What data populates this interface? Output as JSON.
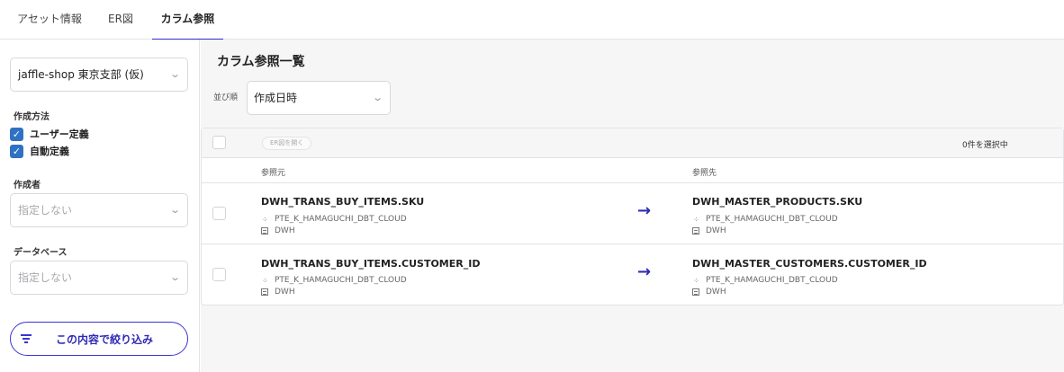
{
  "tabs": [
    {
      "label": "アセット情報"
    },
    {
      "label": "ER図"
    },
    {
      "label": "カラム参照"
    }
  ],
  "sidebar": {
    "project_select": "jaffle-shop 東京支部 (仮)",
    "method_label": "作成方法",
    "methods": [
      {
        "label": "ユーザー定義",
        "checked": true
      },
      {
        "label": "自動定義",
        "checked": true
      }
    ],
    "creator_label": "作成者",
    "creator_placeholder": "指定しない",
    "database_label": "データベース",
    "database_placeholder": "指定しない",
    "filter_button": "この内容で絞り込み"
  },
  "main": {
    "title": "カラム参照一覧",
    "sort_label": "並び順",
    "sort_value": "作成日時",
    "er_button": "ER図を開く",
    "selected_count": "0件を選択中",
    "header_source": "参照元",
    "header_target": "参照先",
    "rows": [
      {
        "source": {
          "column": "DWH_TRANS_BUY_ITEMS.SKU",
          "project": "PTE_K_HAMAGUCHI_DBT_CLOUD",
          "database": "DWH"
        },
        "target": {
          "column": "DWH_MASTER_PRODUCTS.SKU",
          "project": "PTE_K_HAMAGUCHI_DBT_CLOUD",
          "database": "DWH"
        }
      },
      {
        "source": {
          "column": "DWH_TRANS_BUY_ITEMS.CUSTOMER_ID",
          "project": "PTE_K_HAMAGUCHI_DBT_CLOUD",
          "database": "DWH"
        },
        "target": {
          "column": "DWH_MASTER_CUSTOMERS.CUSTOMER_ID",
          "project": "PTE_K_HAMAGUCHI_DBT_CLOUD",
          "database": "DWH"
        }
      }
    ]
  },
  "colors": {
    "accent": "#2f2ab5",
    "checkbox": "#2f72c4"
  },
  "icons": {
    "arrow": "→",
    "chevron": "⌄",
    "project": "⁘"
  }
}
